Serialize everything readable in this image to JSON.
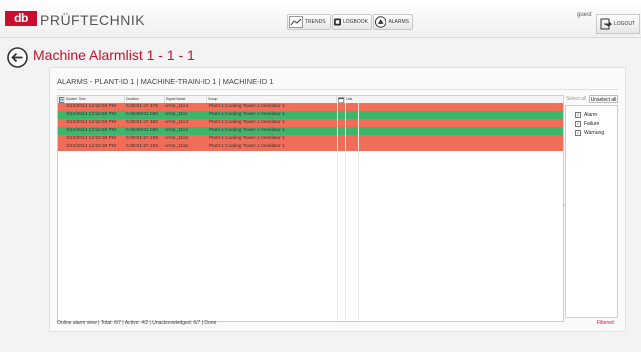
{
  "header": {
    "logo_text": "db",
    "brand": "PRÜFTECHNIK",
    "nav": {
      "trends": "TRENDS",
      "logbook": "LOGBOOK",
      "alarms": "ALARMS"
    },
    "user": "guest",
    "logout": "LOGOUT"
  },
  "page": {
    "title": "Machine Alarmlist 1 - 1 - 1",
    "breadcrumb": "ALARMS - PLANT-ID 1  |  MACHINE-TRAIN-ID 1  |  MACHINE-ID 1"
  },
  "table": {
    "columns": {
      "system_time": "System Time",
      "duration": "Duration",
      "signal_name": "Signal Name",
      "group": "Group",
      "link": "Link"
    },
    "rows": [
      {
        "time": "3/10/2014 12:52:50 PM",
        "duration": "0.00:01:47.475",
        "signal": "vrms_1114",
        "group": "Plant 1.Cooling Tower 1.Ventilator 1",
        "status": "alarm"
      },
      {
        "time": "3/10/2014 12:52:50 PM",
        "duration": "0.00:00:01.030",
        "signal": "vrms_1111",
        "group": "Plant 1.Cooling Tower 1.Ventilator 1",
        "status": "ok"
      },
      {
        "time": "3/10/2014 12:52:50 PM",
        "duration": "0.00:01:47.450",
        "signal": "vrms_1113",
        "group": "Plant 1.Cooling Tower 1.Ventilator 1",
        "status": "alarm"
      },
      {
        "time": "3/10/2014 12:52:50 PM",
        "duration": "0.00:00:01.030",
        "signal": "vrms_1112",
        "group": "Plant 1.Cooling Tower 1.Ventilator 1",
        "status": "ok"
      },
      {
        "time": "3/10/2014 12:52:30 PM",
        "duration": "0.00:01:27.159",
        "signal": "vrms_1116",
        "group": "Plant 1.Cooling Tower 1.Ventilator 1",
        "status": "alarm"
      },
      {
        "time": "3/10/2014 12:52:30 PM",
        "duration": "0.00:01:27.159",
        "signal": "vrms_1115",
        "group": "Plant 1.Cooling Tower 1.Ventilator 1",
        "status": "alarm"
      }
    ]
  },
  "filter": {
    "select_all": "Select all",
    "unselect_all": "Unselect all",
    "options": [
      {
        "label": "Alarm",
        "checked": true
      },
      {
        "label": "Failure",
        "checked": true
      },
      {
        "label": "Warnung",
        "checked": true
      }
    ]
  },
  "status_bar": {
    "text": "Online alarm view | Total: 6/7 | Active: 4/2 | Unacknowledged: 6/7 | Done",
    "filtered": "Filtered"
  },
  "colors": {
    "alarm": "#f26d58",
    "ok": "#3db56b",
    "brand": "#c8102e"
  },
  "icons": [
    "back-arrow-icon",
    "trends-icon",
    "logbook-icon",
    "alarms-icon",
    "logout-icon",
    "table-menu-icon",
    "calendar-icon"
  ]
}
